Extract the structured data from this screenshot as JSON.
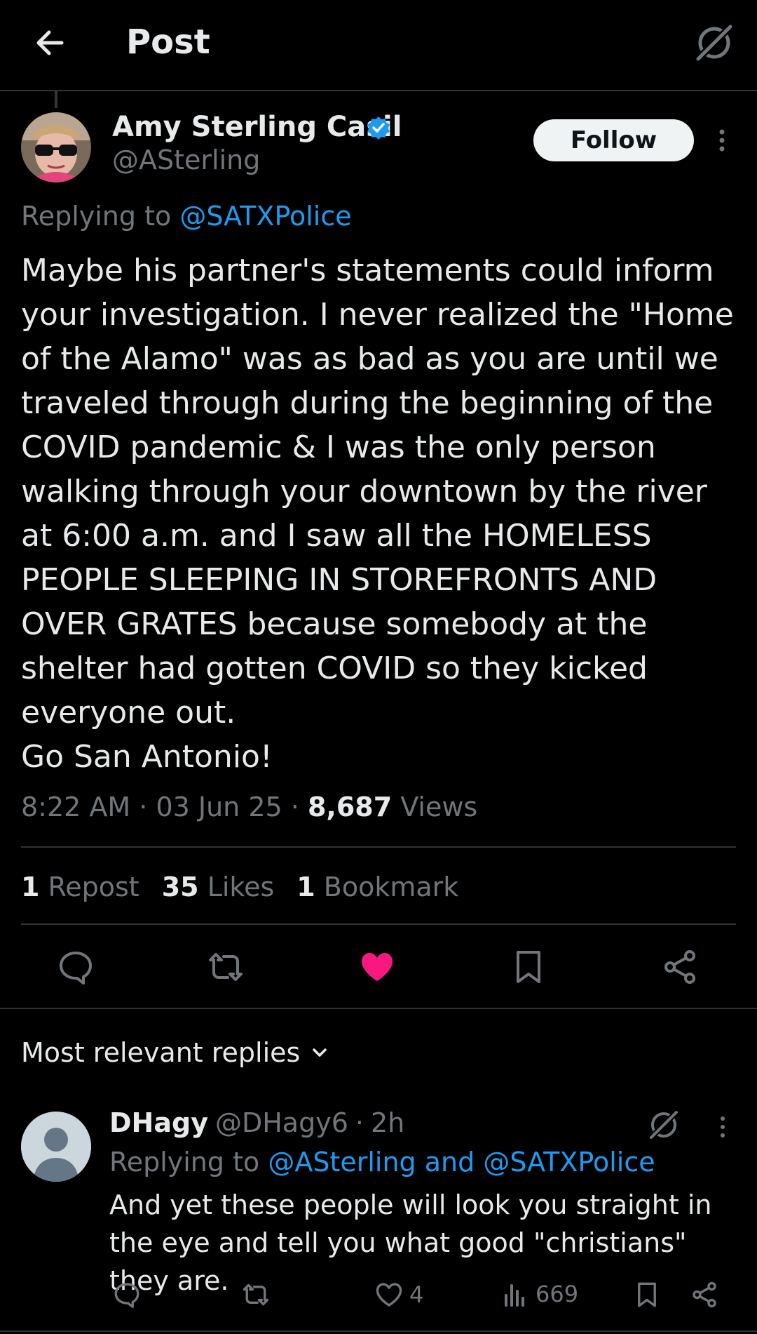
{
  "header": {
    "title": "Post"
  },
  "post": {
    "author_name": "Amy Sterling Casil",
    "author_handle": "@ASterling",
    "follow_label": "Follow",
    "replying_prefix": "Replying to",
    "replying_to": "@SATXPolice",
    "text": "Maybe his partner's statements could inform your investigation. I never realized the \"Home of the Alamo\" was as bad as you are until we traveled through during the beginning of the COVID pandemic & I was the only person walking through your downtown by the river at 6:00 a.m. and I saw all the HOMELESS PEOPLE SLEEPING IN STOREFRONTS AND OVER GRATES because somebody at the shelter had gotten COVID so they kicked everyone out.\nGo San Antonio!",
    "time": "8:22 AM",
    "date": "03 Jun 25",
    "views_count": "8,687",
    "views_label": "Views",
    "stats": {
      "reposts_count": "1",
      "reposts_label": "Repost",
      "likes_count": "35",
      "likes_label": "Likes",
      "bookmarks_count": "1",
      "bookmarks_label": "Bookmark"
    },
    "liked": true
  },
  "replies_section": {
    "sort_label": "Most relevant replies"
  },
  "reply": {
    "author_name": "DHagy",
    "author_handle": "@DHagy6",
    "age": "2h",
    "replying_prefix": "Replying to",
    "replying_to": "@ASterling and @SATXPolice",
    "text": "And yet these people will look you straight in the eye and tell you what good \"christians\" they are.",
    "likes": "4",
    "views": "669"
  },
  "colors": {
    "background": "#000000",
    "text": "#e7e9ea",
    "muted": "#71767b",
    "link": "#1d9bf0",
    "like_active": "#f91880",
    "divider": "#2f3336"
  },
  "icons": [
    "back-arrow-icon",
    "grok-icon",
    "verified-badge-icon",
    "more-icon",
    "reply-icon",
    "repost-icon",
    "heart-icon",
    "bookmark-icon",
    "share-icon",
    "chevron-down-icon",
    "views-icon"
  ]
}
